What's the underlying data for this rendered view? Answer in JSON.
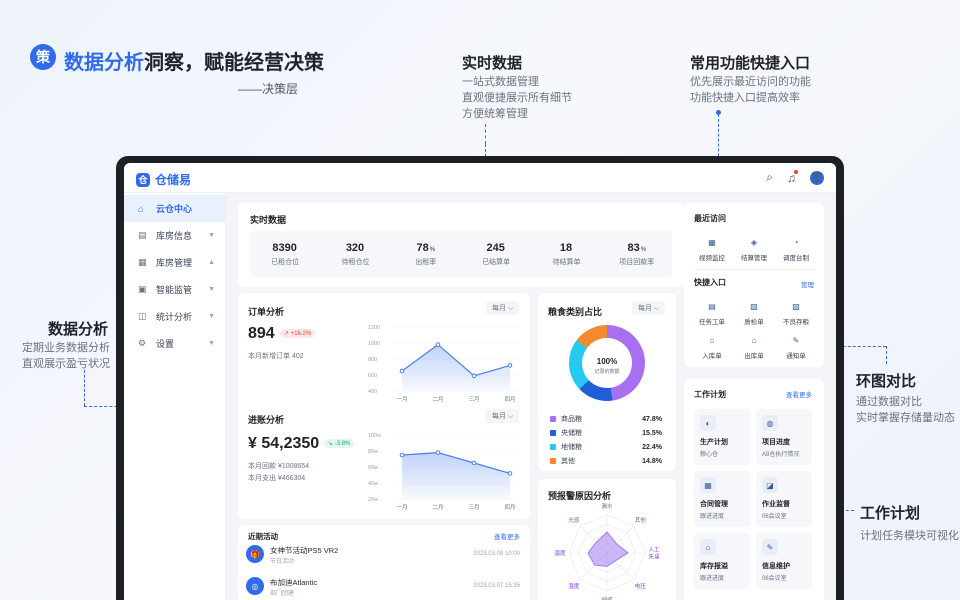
{
  "hero": {
    "badge": "策",
    "title_highlight": "数据分析",
    "title_rest": "洞察，赋能经营决策",
    "subtitle": "——决策层"
  },
  "annotations": {
    "realtime": {
      "title": "实时数据",
      "lines": [
        "一站式数据管理",
        "直观便捷展示所有细节",
        "方便统筹管理"
      ]
    },
    "shortcut": {
      "title": "常用功能快捷入口",
      "lines": [
        "优先展示最近访问的功能",
        "功能快捷入口提高效率"
      ]
    },
    "analysis": {
      "title": "数据分析",
      "lines": [
        "定期业务数据分析",
        "直观展示盈亏状况"
      ]
    },
    "donut": {
      "title": "环图对比",
      "lines": [
        "通过数据对比",
        "实时掌握存储量动态"
      ]
    },
    "plan": {
      "title": "工作计划",
      "lines": [
        "计划任务模块可视化"
      ]
    }
  },
  "app": {
    "logo_mark": "仓",
    "name": "仓储易",
    "avatar": "策",
    "icons": {
      "search": "search-icon",
      "bell": "bell-icon"
    }
  },
  "sidebar": {
    "items": [
      {
        "icon": "⌂",
        "label": "云仓中心",
        "active": true,
        "caret": ""
      },
      {
        "icon": "▤",
        "label": "库房信息",
        "active": false,
        "caret": "▼"
      },
      {
        "icon": "▦",
        "label": "库房管理",
        "active": false,
        "caret": "▲"
      },
      {
        "icon": "▣",
        "label": "智能监管",
        "active": false,
        "caret": "▼"
      },
      {
        "icon": "◫",
        "label": "统计分析",
        "active": false,
        "caret": "▼"
      },
      {
        "icon": "⚙",
        "label": "设置",
        "active": false,
        "caret": "▼"
      }
    ]
  },
  "realtime": {
    "title": "实时数据",
    "stats": [
      {
        "value": "8390",
        "unit": "",
        "label": "已租仓位"
      },
      {
        "value": "320",
        "unit": "",
        "label": "待租仓位"
      },
      {
        "value": "78",
        "unit": "%",
        "label": "出租率"
      },
      {
        "value": "245",
        "unit": "",
        "label": "已结算单"
      },
      {
        "value": "18",
        "unit": "",
        "label": "待结算单"
      },
      {
        "value": "83",
        "unit": "%",
        "label": "项目回款率"
      }
    ]
  },
  "orders": {
    "title": "订单分析",
    "period": "每月 ⌵",
    "value": "894",
    "change": "↗ +16.2%",
    "note": "本月新增订单 402"
  },
  "income": {
    "title": "进账分析",
    "period": "每月 ⌵",
    "value": "¥ 54,2350",
    "change": "↘ -3.8%",
    "note1": "本月回款 ¥1008654",
    "note2": "本月支出 ¥466304"
  },
  "chart_data": [
    {
      "type": "area",
      "title": "订单分析",
      "categories": [
        "一月",
        "二月",
        "三月",
        "四月"
      ],
      "series": [
        {
          "values": [
            650,
            980,
            590,
            720
          ]
        }
      ],
      "yticks": [
        "1200",
        "1000",
        "800",
        "600",
        "400"
      ],
      "ylim": [
        400,
        1200
      ],
      "grid": true,
      "color": "#4a7fe8"
    },
    {
      "type": "area",
      "title": "进账分析",
      "categories": [
        "一月",
        "二月",
        "三月",
        "四月"
      ],
      "series": [
        {
          "values": [
            75,
            78,
            65,
            52
          ]
        }
      ],
      "yticks": [
        "100w",
        "80w",
        "60w",
        "40w",
        "20w"
      ],
      "ylim": [
        20,
        100
      ],
      "grid": true,
      "color": "#4a7fe8"
    },
    {
      "type": "pie",
      "title": "粮食类别占比",
      "center_value": "100%",
      "center_label": "记录的数额",
      "categories": [
        "商品粮",
        "央储粮",
        "地储粮",
        "其他"
      ],
      "values": [
        47.8,
        15.5,
        22.4,
        14.8
      ],
      "colors": [
        "#a86ff0",
        "#1e5fd8",
        "#26c9f0",
        "#f5892d"
      ]
    },
    {
      "type": "radar",
      "title": "预报警原因分析",
      "categories": [
        "漏水",
        "其他",
        "人工失误",
        "电压",
        "烟感",
        "湿度",
        "温度",
        "光感"
      ],
      "series": [
        {
          "values": [
            0.55,
            0.35,
            0.55,
            0.3,
            0.35,
            0.45,
            0.5,
            0.4
          ]
        }
      ],
      "color": "#a27ef0"
    }
  ],
  "donut": {
    "title": "粮食类别占比",
    "period": "每月 ⌵"
  },
  "radar": {
    "title": "预报警原因分析"
  },
  "activity": {
    "title": "近期活动",
    "more": "查看更多",
    "items": [
      {
        "icon": "🎁",
        "title": "女神节活动PS5 VR2",
        "sub": "节日活动",
        "time": "2023.03.08 10:00"
      },
      {
        "icon": "◎",
        "title": "布加迪Atlantic",
        "sub": "部门团建",
        "time": "2023.03.07 15:35"
      }
    ]
  },
  "recent": {
    "title": "最近访问",
    "items": [
      {
        "icon": "▦",
        "label": "视频监控"
      },
      {
        "icon": "◈",
        "label": "结算管理"
      },
      {
        "icon": "◔",
        "label": "调度台制"
      }
    ]
  },
  "quick": {
    "title": "快捷入口",
    "manage": "管理",
    "items": [
      {
        "icon": "▤",
        "label": "任务工单"
      },
      {
        "icon": "▧",
        "label": "质检单"
      },
      {
        "icon": "▨",
        "label": "不良存粮"
      },
      {
        "icon": "⌂",
        "label": "入库单"
      },
      {
        "icon": "⌂",
        "label": "出库单"
      },
      {
        "icon": "✎",
        "label": "通知单"
      }
    ]
  },
  "plan": {
    "title": "工作计划",
    "more": "查看更多",
    "items": [
      {
        "icon": "◐",
        "title": "生产计划",
        "sub": "粮心仓"
      },
      {
        "icon": "◍",
        "title": "项目进度",
        "sub": "A8仓执行情况"
      },
      {
        "icon": "▦",
        "title": "合同管理",
        "sub": "跟进进度"
      },
      {
        "icon": "◪",
        "title": "作业监督",
        "sub": "06会议室"
      },
      {
        "icon": "⌂",
        "title": "库存报溢",
        "sub": "跟进进度"
      },
      {
        "icon": "✎",
        "title": "信息维护",
        "sub": "06会议室"
      }
    ]
  }
}
